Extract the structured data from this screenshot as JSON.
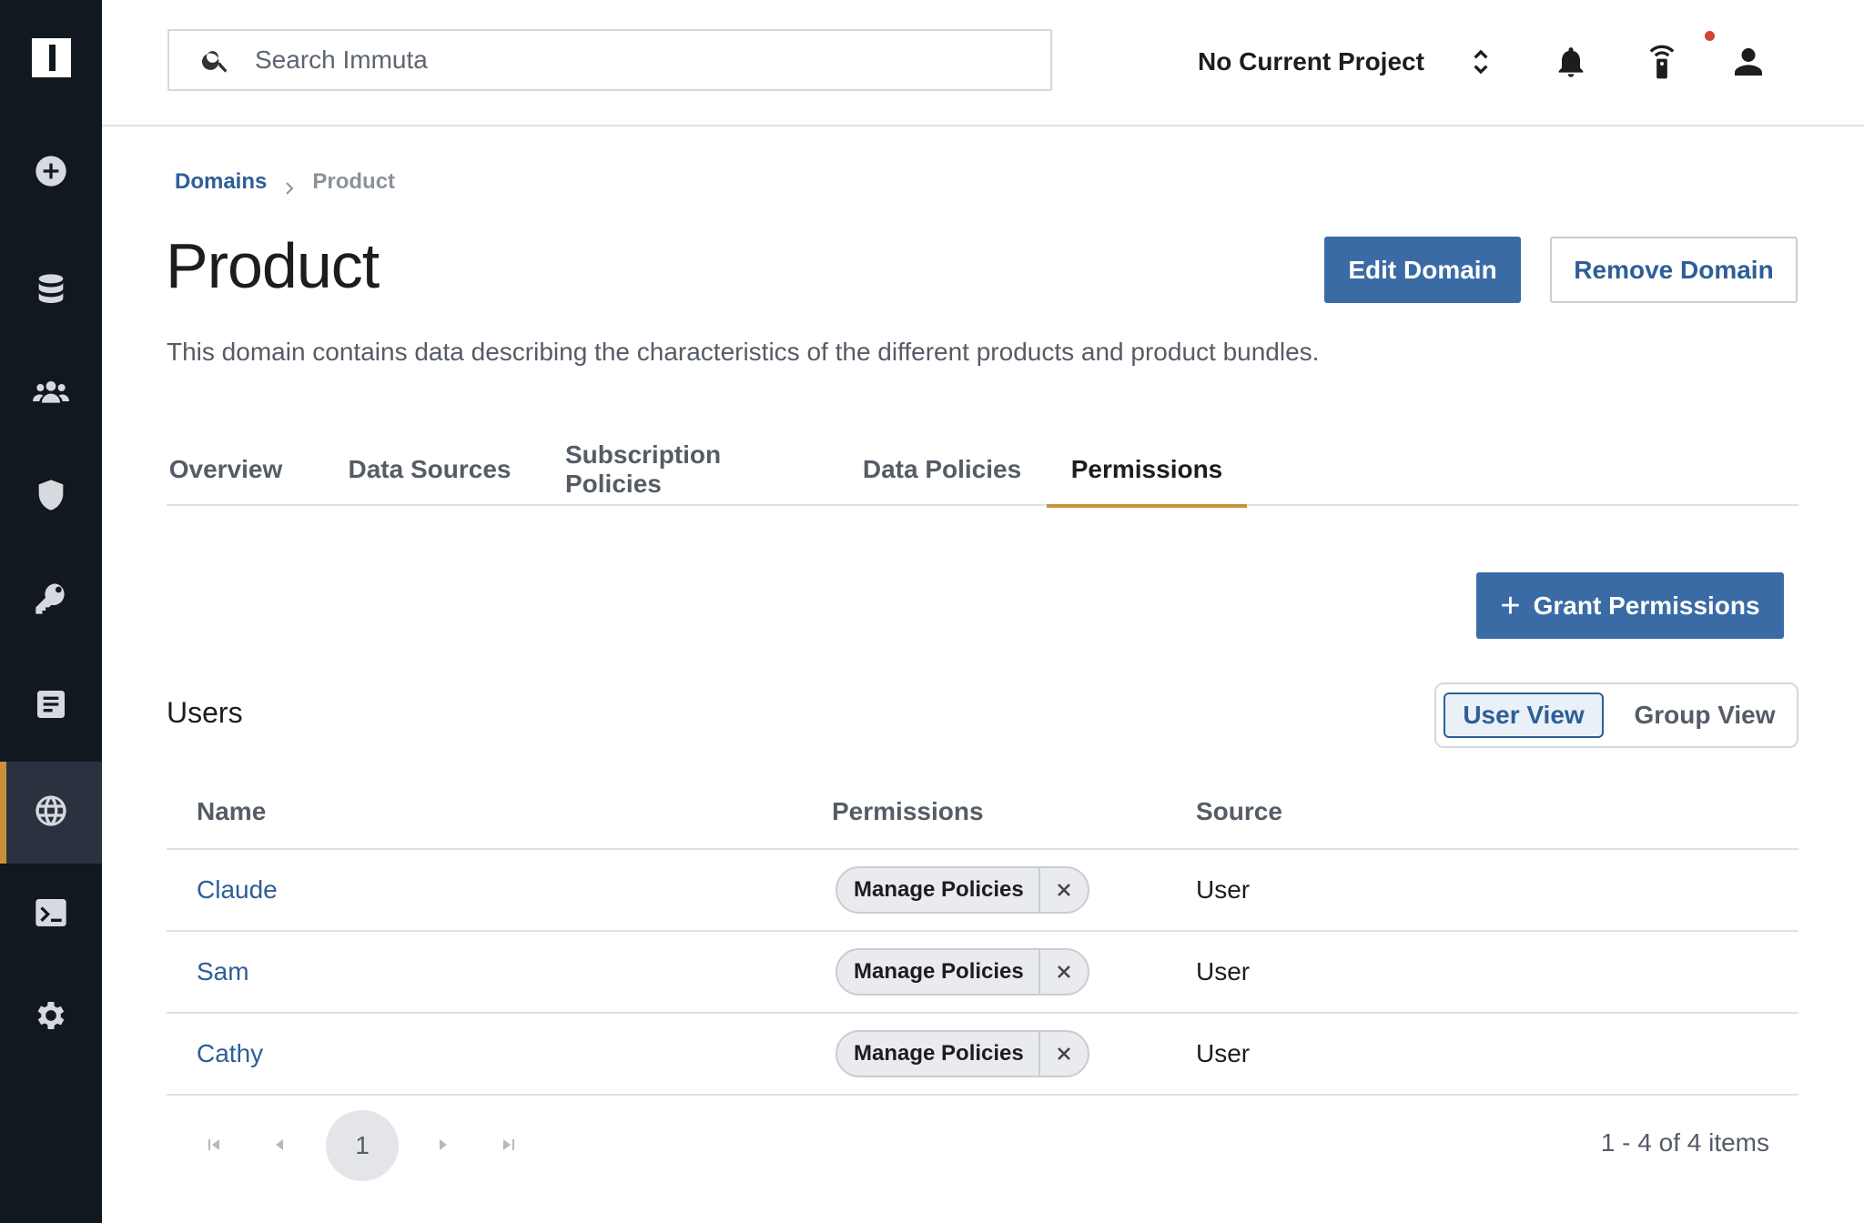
{
  "sidebar": {
    "items": [
      {
        "name": "add-icon"
      },
      {
        "name": "database-icon"
      },
      {
        "name": "people-icon"
      },
      {
        "name": "shield-icon"
      },
      {
        "name": "key-icon"
      },
      {
        "name": "document-icon"
      },
      {
        "name": "globe-icon",
        "active": true
      },
      {
        "name": "terminal-icon"
      },
      {
        "name": "gear-icon"
      }
    ]
  },
  "topbar": {
    "search_placeholder": "Search Immuta",
    "project_label": "No Current Project",
    "icons": [
      "chevron-updown-icon",
      "bell-icon",
      "remote-icon",
      "user-icon"
    ]
  },
  "breadcrumb": {
    "parent": "Domains",
    "current": "Product"
  },
  "page": {
    "title": "Product",
    "description": "This domain contains data describing the characteristics of the different products and product bundles.",
    "edit_label": "Edit Domain",
    "remove_label": "Remove Domain"
  },
  "tabs": [
    {
      "label": "Overview"
    },
    {
      "label": "Data Sources"
    },
    {
      "label": "Subscription Policies"
    },
    {
      "label": "Data Policies"
    },
    {
      "label": "Permissions",
      "active": true
    }
  ],
  "grant_label": "Grant Permissions",
  "users": {
    "title": "Users",
    "view_user": "User View",
    "view_group": "Group View",
    "columns": {
      "name": "Name",
      "permissions": "Permissions",
      "source": "Source"
    },
    "rows": [
      {
        "name": "Claude",
        "permission": "Manage Policies",
        "source": "User"
      },
      {
        "name": "Sam",
        "permission": "Manage Policies",
        "source": "User"
      },
      {
        "name": "Cathy",
        "permission": "Manage Policies",
        "source": "User"
      }
    ]
  },
  "pagination": {
    "current_page": "1",
    "info": "1 - 4 of 4 items"
  },
  "colors": {
    "sidebar_bg": "#111820",
    "primary": "#3b6ba5",
    "link": "#2e5e97",
    "accent": "#c8903a",
    "notification": "#d0462e"
  }
}
